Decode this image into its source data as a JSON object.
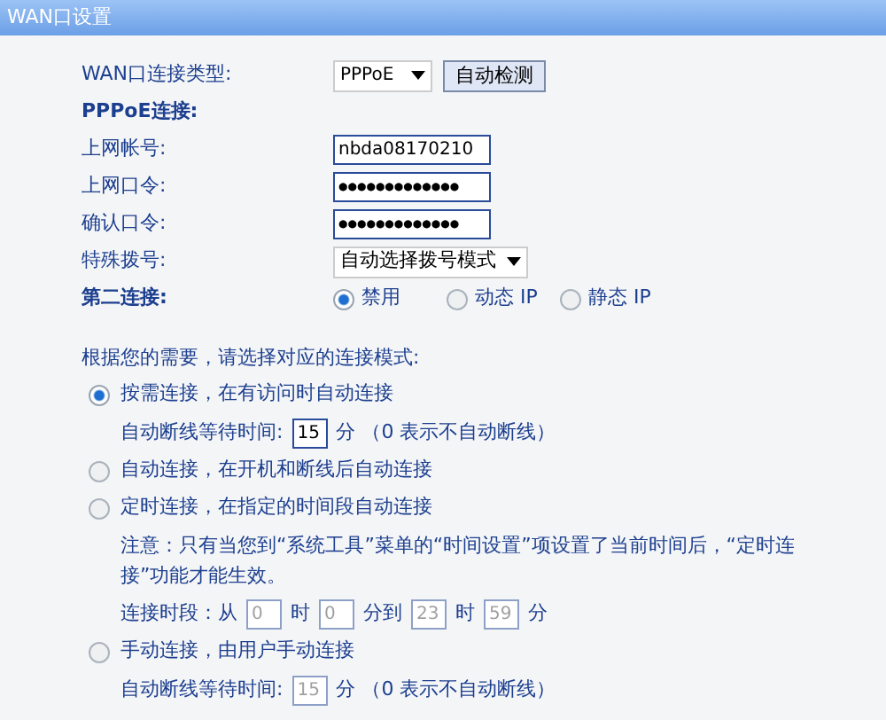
{
  "window": {
    "title": "WAN口设置"
  },
  "wan_type": {
    "label": "WAN口连接类型:",
    "value": "PPPoE",
    "button": "自动检测"
  },
  "pppoe_heading": "PPPoE连接:",
  "fields": [
    {
      "label": "上网帐号:",
      "value": "nbda08170210",
      "kind": "text"
    },
    {
      "label": "上网口令:",
      "value": "●●●●●●●●●●●●●",
      "kind": "password"
    },
    {
      "label": "确认口令:",
      "value": "●●●●●●●●●●●●●",
      "kind": "password"
    }
  ],
  "special_dial": {
    "label": "特殊拨号:",
    "value": "自动选择拨号模式"
  },
  "second_connection": {
    "label": "第二连接:",
    "options": [
      {
        "label": "禁用",
        "selected": true
      },
      {
        "label": "动态 IP",
        "selected": false
      },
      {
        "label": "静态 IP",
        "selected": false
      }
    ]
  },
  "modes": {
    "intro": "根据您的需要，请选择对应的连接模式:",
    "options": [
      {
        "label": "按需连接，在有访问时自动连接",
        "selected": true,
        "details": [
          {
            "kind": "line",
            "disabled": false,
            "parts": [
              {
                "kind": "text",
                "text": "自动断线等待时间:"
              },
              {
                "kind": "field",
                "value": "15"
              },
              {
                "kind": "text",
                "text": "分 （0 表示不自动断线）"
              }
            ]
          }
        ]
      },
      {
        "label": "自动连接，在开机和断线后自动连接",
        "selected": false
      },
      {
        "label": "定时连接，在指定的时间段自动连接",
        "selected": false,
        "details": [
          {
            "kind": "note",
            "text": "注意：只有当您到“系统工具”菜单的“时间设置”项设置了当前时间后，“定时连接”功能才能生效。"
          },
          {
            "kind": "line",
            "disabled": true,
            "parts": [
              {
                "kind": "text",
                "text": "连接时段：从"
              },
              {
                "kind": "field",
                "value": "0"
              },
              {
                "kind": "text",
                "text": "时"
              },
              {
                "kind": "field",
                "value": "0"
              },
              {
                "kind": "text",
                "text": "分到"
              },
              {
                "kind": "field",
                "value": "23"
              },
              {
                "kind": "text",
                "text": "时"
              },
              {
                "kind": "field",
                "value": "59"
              },
              {
                "kind": "text",
                "text": "分"
              }
            ]
          }
        ]
      },
      {
        "label": "手动连接，由用户手动连接",
        "selected": false,
        "details": [
          {
            "kind": "line",
            "disabled": true,
            "parts": [
              {
                "kind": "text",
                "text": "自动断线等待时间:"
              },
              {
                "kind": "field",
                "value": "15"
              },
              {
                "kind": "text",
                "text": "分 （0 表示不自动断线）"
              }
            ]
          }
        ]
      }
    ]
  }
}
